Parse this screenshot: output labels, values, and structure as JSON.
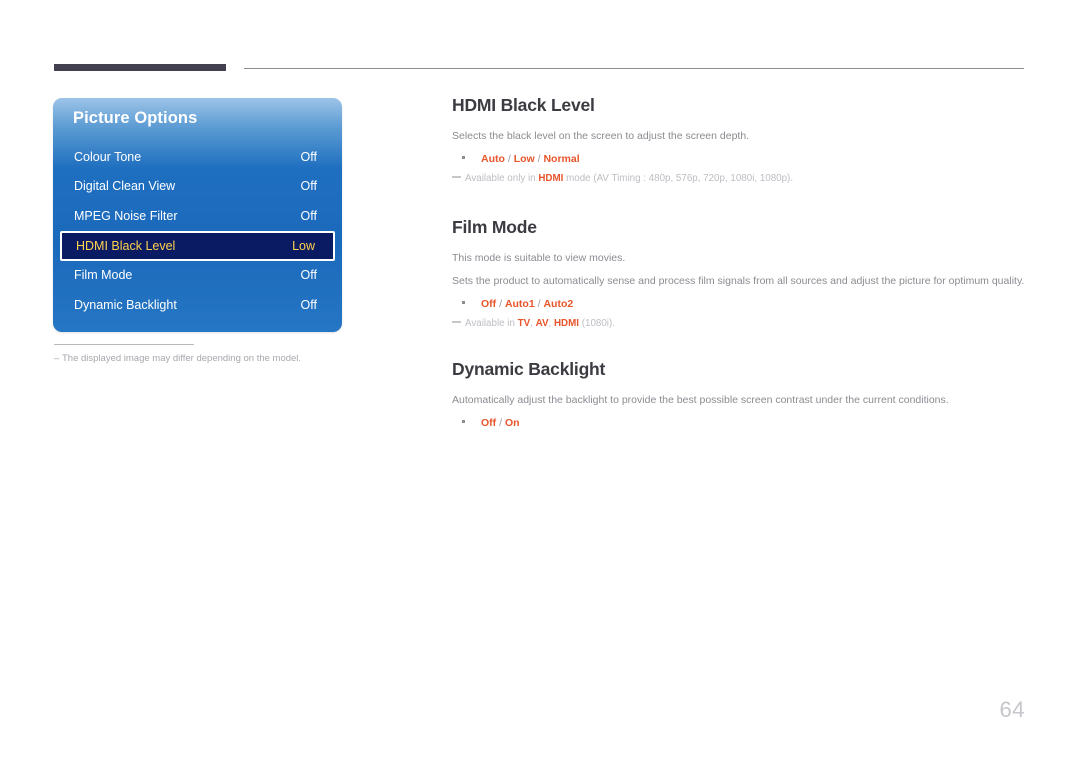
{
  "page": {
    "number": "64"
  },
  "osd": {
    "title": "Picture Options",
    "rows": [
      {
        "label": "Colour Tone",
        "value": "Off",
        "selected": false
      },
      {
        "label": "Digital Clean View",
        "value": "Off",
        "selected": false
      },
      {
        "label": "MPEG Noise Filter",
        "value": "Off",
        "selected": false
      },
      {
        "label": "HDMI Black Level",
        "value": "Low",
        "selected": true
      },
      {
        "label": "Film Mode",
        "value": "Off",
        "selected": false
      },
      {
        "label": "Dynamic Backlight",
        "value": "Off",
        "selected": false
      }
    ],
    "colors": {
      "panel_blue": "#1b69bb",
      "selected_bg": "#0a1a63",
      "selected_text": "#ffd24d"
    }
  },
  "figure_note": {
    "dash": "–",
    "text": "The displayed image may differ depending on the model."
  },
  "sections": [
    {
      "title": "HDMI Black Level",
      "paragraphs": [
        "Selects the black level on the screen to adjust the screen depth."
      ],
      "options": {
        "items": [
          "Auto",
          "Low",
          "Normal"
        ],
        "separator": " / "
      },
      "note": {
        "prefix": "Available only in ",
        "emphasis": "HDMI",
        "suffix": " mode (AV Timing : 480p, 576p, 720p, 1080i, 1080p)."
      }
    },
    {
      "title": "Film Mode",
      "paragraphs": [
        "This mode is suitable to view movies.",
        "Sets the product to automatically sense and process film signals from all sources and adjust the picture for optimum quality."
      ],
      "options": {
        "items": [
          "Off",
          "Auto1",
          "Auto2"
        ],
        "separator": " / "
      },
      "note": {
        "prefix": "Available in ",
        "emphasis": "TV",
        "emphasis2": "AV",
        "emphasis3": "HDMI",
        "suffix": " (1080i)."
      }
    },
    {
      "title": "Dynamic Backlight",
      "paragraphs": [
        "Automatically adjust the backlight to provide the best possible screen contrast under the current conditions."
      ],
      "options": {
        "items": [
          "Off",
          "On"
        ],
        "separator": " / "
      },
      "note": null
    }
  ],
  "colors": {
    "heading": "#3b3b42",
    "body": "#8b8b92",
    "accent": "#e8552a",
    "note": "#bdbdc3",
    "rule_dark": "#43414f"
  }
}
